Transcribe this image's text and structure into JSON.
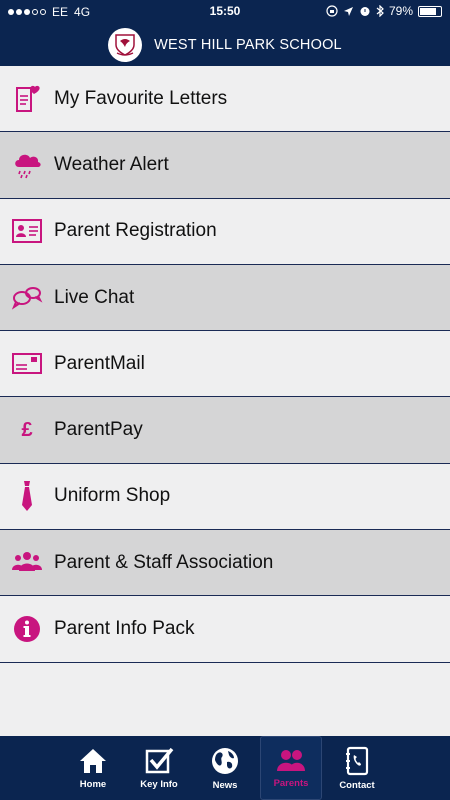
{
  "status": {
    "carrier": "EE",
    "network": "4G",
    "time": "15:50",
    "battery": "79%",
    "battery_level": 0.79
  },
  "header": {
    "title": "WEST HILL PARK SCHOOL"
  },
  "menu": {
    "items": [
      {
        "label": "My Favourite Letters",
        "icon": "heart-letter-icon"
      },
      {
        "label": "Weather Alert",
        "icon": "rain-cloud-icon"
      },
      {
        "label": "Parent Registration",
        "icon": "id-card-icon"
      },
      {
        "label": "Live Chat",
        "icon": "chat-bubbles-icon"
      },
      {
        "label": "ParentMail",
        "icon": "envelope-icon"
      },
      {
        "label": "ParentPay",
        "icon": "pound-icon"
      },
      {
        "label": "Uniform Shop",
        "icon": "tie-icon"
      },
      {
        "label": "Parent & Staff Association",
        "icon": "people-icon"
      },
      {
        "label": "Parent Info Pack",
        "icon": "info-icon"
      }
    ]
  },
  "tabs": [
    {
      "label": "Home",
      "icon": "home-icon"
    },
    {
      "label": "Key Info",
      "icon": "checkbox-icon"
    },
    {
      "label": "News",
      "icon": "globe-icon"
    },
    {
      "label": "Parents",
      "icon": "parents-icon",
      "active": true
    },
    {
      "label": "Contact",
      "icon": "address-book-icon"
    }
  ],
  "colors": {
    "navy": "#0b2550",
    "accent": "#c8157f",
    "row_light": "#efeff0",
    "row_dark": "#d5d5d6"
  }
}
